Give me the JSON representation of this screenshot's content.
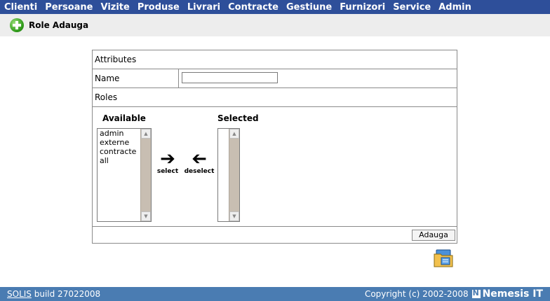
{
  "nav": {
    "items": [
      "Clienti",
      "Persoane",
      "Vizite",
      "Produse",
      "Livrari",
      "Contracte",
      "Gestiune",
      "Furnizori",
      "Service",
      "Admin"
    ]
  },
  "header": {
    "title": "Role Adauga",
    "icon": "add-icon"
  },
  "form": {
    "attributes_label": "Attributes",
    "name_label": "Name",
    "name_value": "",
    "roles_label": "Roles",
    "available_heading": "Available",
    "selected_heading": "Selected",
    "available_options": [
      "admin",
      "externe",
      "contracte",
      "all"
    ],
    "selected_options": [],
    "select_label": "select",
    "deselect_label": "deselect",
    "submit_label": "Adauga"
  },
  "footer": {
    "app_name": "SOLIS",
    "build": "build 27022008",
    "copyright": "Copyright (c) 2002-2008",
    "brand": "Nemesis IT"
  },
  "colors": {
    "nav_bg": "#2e4f9a",
    "footer_bg": "#4a7cb2",
    "title_bg": "#ededed"
  }
}
